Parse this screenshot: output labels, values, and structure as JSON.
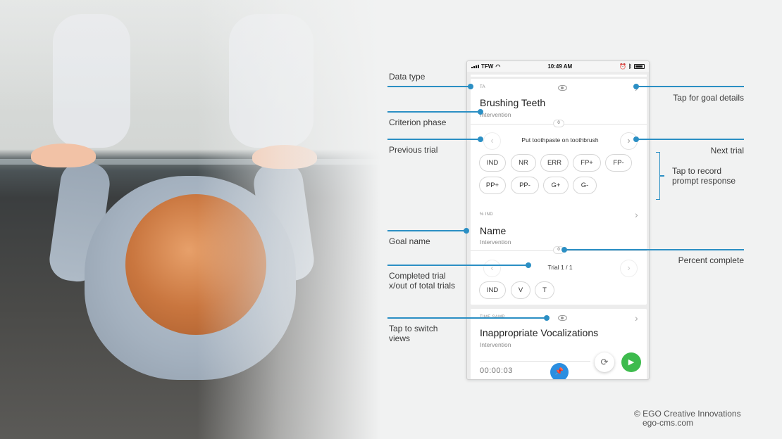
{
  "status_bar": {
    "carrier": "TFW",
    "time": "10:49 AM"
  },
  "goals": [
    {
      "data_type": "TA",
      "title": "Brushing Teeth",
      "phase": "Intervention",
      "progress_badge": "0",
      "trial_label": "Put toothpaste on toothbrush",
      "responses": [
        "IND",
        "NR",
        "ERR",
        "FP+",
        "FP-",
        "PP+",
        "PP-",
        "G+",
        "G-"
      ]
    },
    {
      "data_type": "% IND",
      "title": "Name",
      "phase": "Intervention",
      "progress_badge": "0",
      "trial_label": "Trial 1 / 1",
      "responses": [
        "IND",
        "V",
        "T"
      ]
    },
    {
      "data_type": "TIME SAMP",
      "title": "Inappropriate Vocalizations",
      "phase": "Intervention",
      "timer": "00:00:03"
    }
  ],
  "annotations": {
    "data_type": "Data type",
    "criterion_phase": "Criterion phase",
    "previous_trial": "Previous trial",
    "goal_name": "Goal name",
    "completed_trial_1": "Completed trial",
    "completed_trial_2": "x/out of total trials",
    "switch_views_1": "Tap to switch",
    "switch_views_2": "views",
    "goal_details": "Tap for goal details",
    "next_trial": "Next trial",
    "record_prompt_1": "Tap to record",
    "record_prompt_2": "prompt response",
    "percent_complete": "Percent complete"
  },
  "credit": {
    "line1": "© EGO Creative Innovations",
    "line2": "ego-cms.com"
  },
  "colors": {
    "accent": "#2b8fc4",
    "play": "#3dbb4d",
    "pin": "#2b8ee0"
  },
  "icons": [
    "eye-icon",
    "chevron-right-icon",
    "chevron-left-icon",
    "sync-icon",
    "play-icon",
    "pin-icon",
    "battery-icon",
    "wifi-icon",
    "signal-icon"
  ]
}
